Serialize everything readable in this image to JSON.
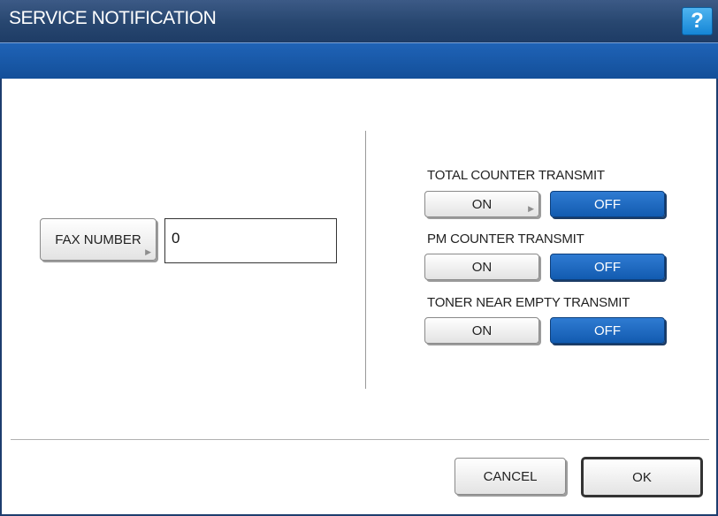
{
  "window": {
    "title": "SERVICE NOTIFICATION",
    "help_label": "?"
  },
  "fax": {
    "button_label": "FAX NUMBER",
    "value": "0"
  },
  "settings": [
    {
      "label": "TOTAL COUNTER TRANSMIT",
      "on_label": "ON",
      "off_label": "OFF",
      "selected": "OFF"
    },
    {
      "label": "PM COUNTER TRANSMIT",
      "on_label": "ON",
      "off_label": "OFF",
      "selected": "OFF"
    },
    {
      "label": "TONER NEAR EMPTY TRANSMIT",
      "on_label": "ON",
      "off_label": "OFF",
      "selected": "OFF"
    }
  ],
  "footer": {
    "cancel_label": "CANCEL",
    "ok_label": "OK"
  },
  "colors": {
    "title_bar": "#27466f",
    "sub_bar": "#1a5aa8",
    "selected_button": "#1f6bc2",
    "help_button": "#2a9be4"
  }
}
